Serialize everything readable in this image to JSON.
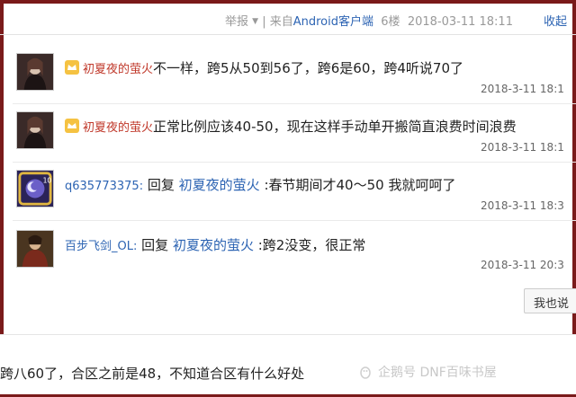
{
  "header": {
    "report_label": "举报",
    "from_prefix": "| 来自",
    "from_client": "Android客户端",
    "floor": "6楼",
    "datetime": "2018-03-11 18:11",
    "collapse_label": "收起"
  },
  "comments": [
    {
      "username": "初夏夜的萤火",
      "text": "不一样，跨5从50到56了，跨6是60，跨4听说70了",
      "time": "2018-3-11 18:1"
    },
    {
      "username": "初夏夜的萤火",
      "text": "正常比例应该40-50，现在这样手动单开搬简直浪费时间浪费",
      "time": "2018-3-11 18:1"
    },
    {
      "username": "q635773375:",
      "reply_word": "回复",
      "reply_target": "初夏夜的萤火",
      "text": ":春节期间才40～50 我就呵呵了",
      "time": "2018-3-11 18:3",
      "badge_text": "10"
    },
    {
      "username": "百步飞剑_OL:",
      "reply_word": "回复",
      "reply_target": "初夏夜的萤火",
      "text": ":跨2没变，很正常",
      "time": "2018-3-11 20:3"
    }
  ],
  "reply_button_label": "我也说",
  "bottom_post_text": "跨八60了，合区之前是48，不知道合区有什么好处",
  "watermark_text": "企鹅号 DNF百味书屋",
  "colors": {
    "frame": "#7a1a1a",
    "link_blue": "#2d64b3",
    "username_red": "#c0392b"
  }
}
